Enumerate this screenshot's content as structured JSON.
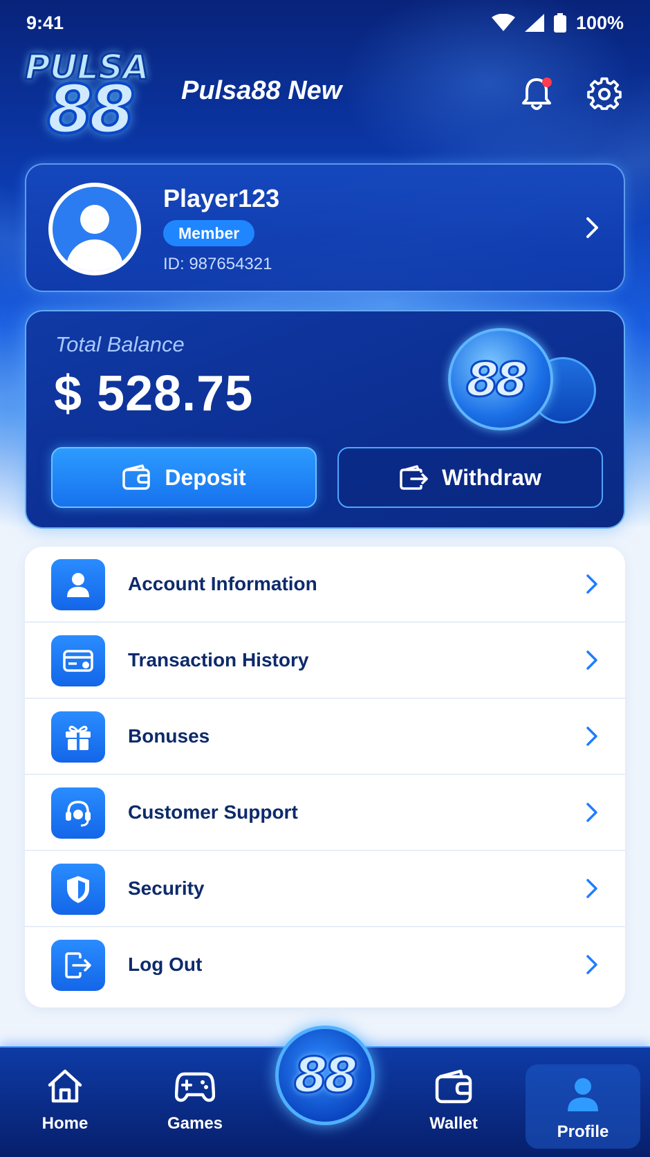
{
  "status_bar": {
    "time": "9:41",
    "battery": "100%"
  },
  "header": {
    "logo_top": "PULSA",
    "logo_bottom": "88",
    "title": "Pulsa88 New"
  },
  "profile": {
    "name": "Player123",
    "badge": "Member",
    "id": "ID: 987654321"
  },
  "balance": {
    "label": "Total Balance",
    "amount": "$ 528.75",
    "coin_text": "88",
    "deposit_label": "Deposit",
    "withdraw_label": "Withdraw"
  },
  "menu": {
    "items": [
      {
        "label": "Account Information",
        "icon": "user-icon"
      },
      {
        "label": "Transaction History",
        "icon": "card-icon"
      },
      {
        "label": "Bonuses",
        "icon": "gift-icon"
      },
      {
        "label": "Customer Support",
        "icon": "headset-icon"
      },
      {
        "label": "Security",
        "icon": "shield-icon"
      },
      {
        "label": "Log Out",
        "icon": "logout-icon"
      }
    ]
  },
  "bottom_nav": {
    "home": "Home",
    "games": "Games",
    "center": "88",
    "wallet": "Wallet",
    "profile": "Profile",
    "active": "profile"
  },
  "colors": {
    "accent": "#1f86ff",
    "primary_dark": "#0c2f92",
    "text_dark": "#0d2a6b",
    "notification": "#ff3b4d"
  }
}
